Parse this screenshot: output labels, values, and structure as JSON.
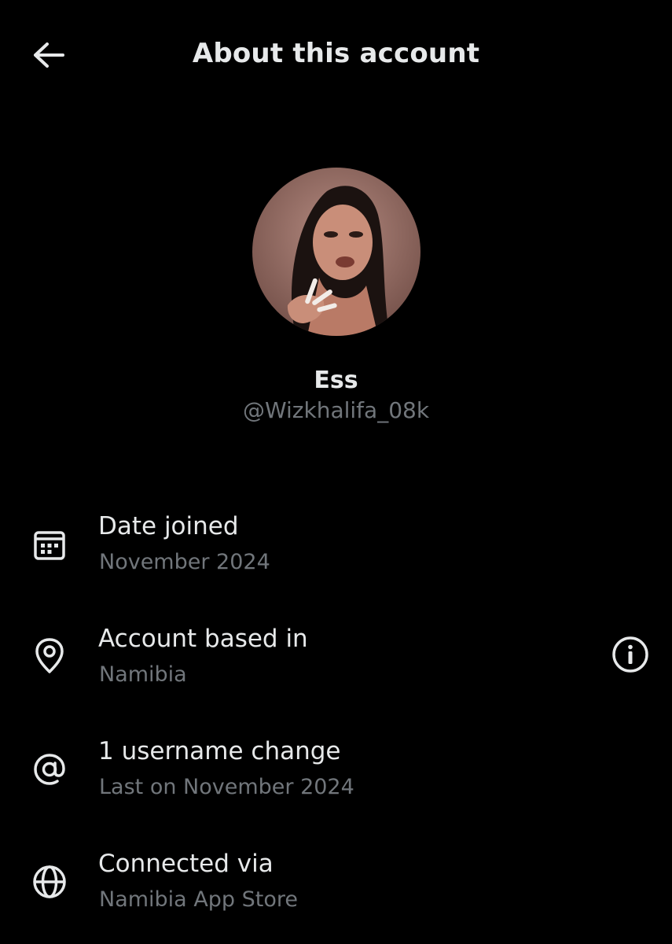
{
  "header": {
    "title": "About this account",
    "back_icon": "arrow-left-icon"
  },
  "profile": {
    "display_name": "Ess",
    "handle": "@Wizkhalifa_08k"
  },
  "rows": [
    {
      "icon": "calendar-icon",
      "title": "Date joined",
      "subtitle": "November 2024"
    },
    {
      "icon": "location-pin-icon",
      "title": "Account based in",
      "subtitle": "Namibia",
      "trailing_icon": "info-icon"
    },
    {
      "icon": "at-sign-icon",
      "title": "1 username change",
      "subtitle": "Last on November 2024"
    },
    {
      "icon": "globe-icon",
      "title": "Connected via",
      "subtitle": "Namibia App Store"
    }
  ],
  "colors": {
    "background": "#000000",
    "primary_text": "#e7e9ea",
    "secondary_text": "#71767b"
  }
}
